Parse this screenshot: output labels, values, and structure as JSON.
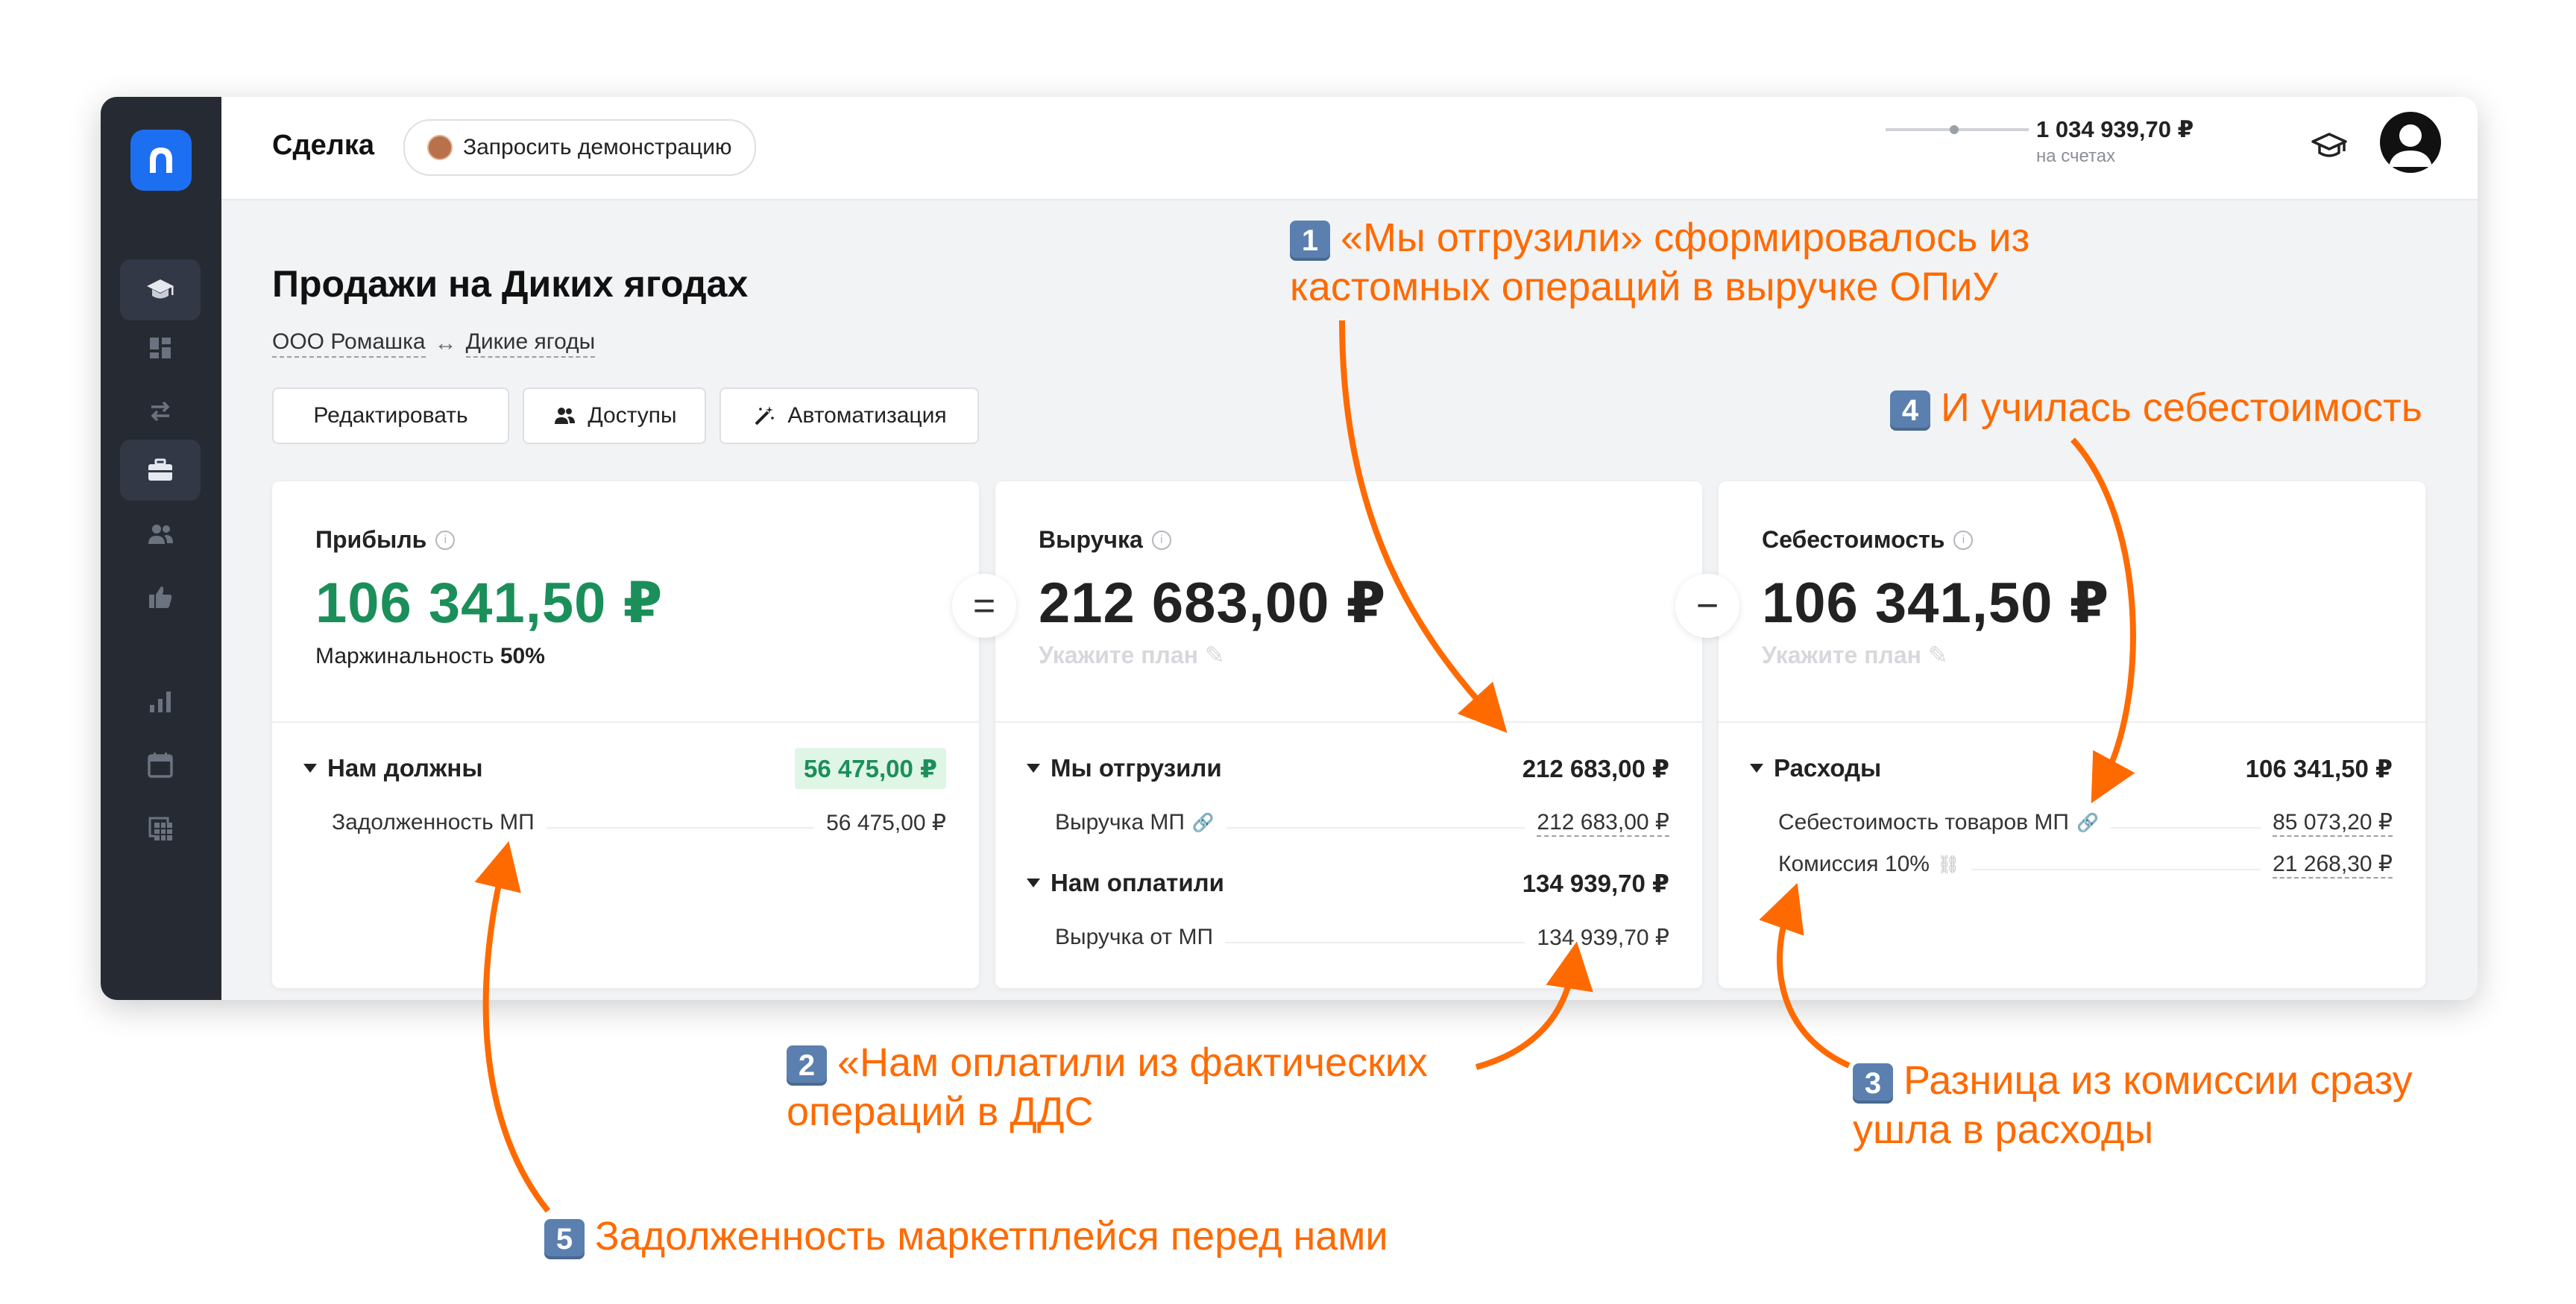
{
  "app": {
    "title": "Сделка",
    "demo_button": "Запросить демонстрацию",
    "balance": "1 034 939,70 ₽",
    "balance_caption": "на счетах"
  },
  "page": {
    "title": "Продажи на Диких ягодах",
    "breadcrumb": {
      "from": "ООО Ромашка",
      "arrow": "↔",
      "to": "Дикие ягоды"
    },
    "buttons": {
      "edit": "Редактировать",
      "access": "Доступы",
      "automation": "Автоматизация"
    }
  },
  "cards": {
    "profit": {
      "label": "Прибыль",
      "value": "106 341,50 ₽",
      "margin_label": "Маржинальность",
      "margin_value": "50%",
      "section": {
        "title": "Нам должны",
        "total": "56 475,00 ₽",
        "rows": [
          {
            "label": "Задолженность МП",
            "value": "56 475,00 ₽"
          }
        ]
      }
    },
    "revenue": {
      "label": "Выручка",
      "value": "212 683,00 ₽",
      "plan": "Укажите план",
      "sections": [
        {
          "title": "Мы отгрузили",
          "total": "212 683,00 ₽",
          "rows": [
            {
              "label": "Выручка МП",
              "value": "212 683,00 ₽"
            }
          ]
        },
        {
          "title": "Нам оплатили",
          "total": "134 939,70 ₽",
          "rows": [
            {
              "label": "Выручка от МП",
              "value": "134 939,70 ₽"
            }
          ]
        }
      ]
    },
    "cost": {
      "label": "Себестоимость",
      "value": "106 341,50 ₽",
      "plan": "Укажите план",
      "section": {
        "title": "Расходы",
        "total": "106 341,50 ₽",
        "rows": [
          {
            "label": "Себестоимость товаров МП",
            "value": "85 073,20 ₽"
          },
          {
            "label": "Комиссия 10%",
            "value": "21 268,30 ₽"
          }
        ]
      }
    }
  },
  "operators": {
    "equals": "=",
    "minus": "−"
  },
  "annotations": [
    {
      "num": "1",
      "line1": "«Мы отгрузили» сформировалось из",
      "line2": "кастомных операций в выручке ОПиУ"
    },
    {
      "num": "2",
      "line1": "«Нам оплатили из фактических",
      "line2": "операций в ДДС"
    },
    {
      "num": "3",
      "line1": "Разница из комиссии сразу",
      "line2": "ушла в расходы"
    },
    {
      "num": "4",
      "line1": "И училась себестоимость"
    },
    {
      "num": "5",
      "line1": "Задолженность маркетплейся перед нами"
    }
  ],
  "colors": {
    "accent": "#ff6a00",
    "green": "#1b8f5a",
    "sidebar": "#262b33",
    "logo": "#1d6ff2"
  }
}
